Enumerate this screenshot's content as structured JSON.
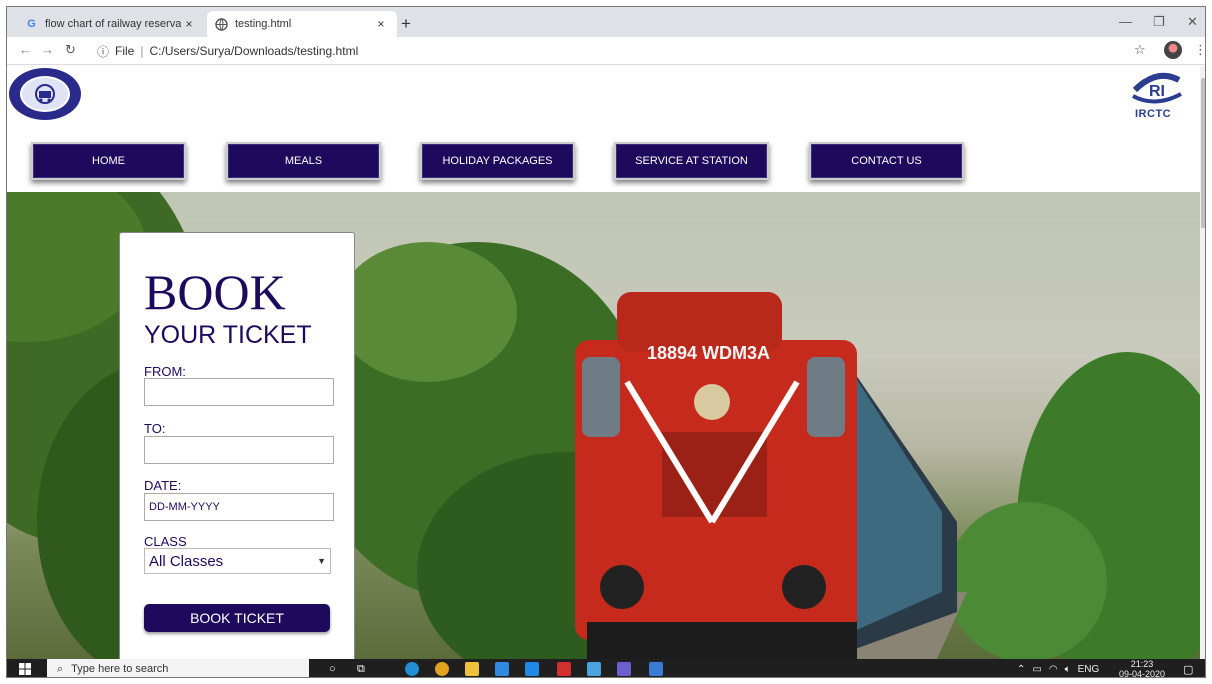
{
  "browser": {
    "tabs": [
      {
        "title": "flow chart of railway reservation",
        "close": "×",
        "favicon": "G"
      },
      {
        "title": "testing.html",
        "close": "×"
      }
    ],
    "new_tab": "+",
    "window_controls": {
      "minimize": "—",
      "restore": "❐",
      "close": "✕"
    },
    "url_prefix": "File",
    "url": "C:/Users/Surya/Downloads/testing.html"
  },
  "site": {
    "logo_right_text": "IRCTC",
    "nav": [
      "HOME",
      "MEALS",
      "HOLIDAY PACKAGES",
      "SERVICE AT STATION",
      "CONTACT US"
    ],
    "loco_number": "18894 WDM3A"
  },
  "booking": {
    "title": "BOOK",
    "subtitle": "YOUR TICKET",
    "from_label": "FROM:",
    "from_value": "",
    "to_label": "TO:",
    "to_value": "",
    "date_label": "DATE:",
    "date_placeholder": "DD-MM-YYYY",
    "class_label": "CLASS",
    "class_selected": "All Classes",
    "button": "BOOK TICKET"
  },
  "taskbar": {
    "search_placeholder": "Type here to search",
    "language": "ENG",
    "time": "21:23",
    "date": "09-04-2020"
  },
  "colors": {
    "brand": "#1e0a5c",
    "tab_bar": "#dee1e6",
    "taskbar": "#1f1f1f"
  }
}
